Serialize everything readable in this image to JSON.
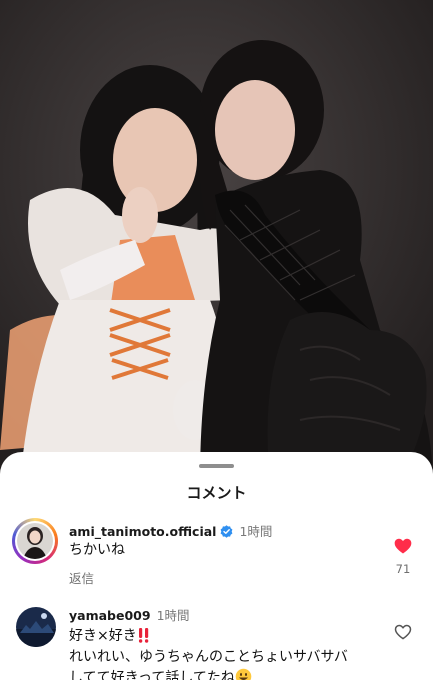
{
  "photo": {
    "description_icon": "photo-of-two-people-icon"
  },
  "comments_sheet": {
    "title": "コメント"
  },
  "comments": [
    {
      "username": "ami_tanimoto.official",
      "verified": true,
      "time": "1時間",
      "text": "ちかいね",
      "reply_label": "返信",
      "liked": true,
      "like_count": "71"
    },
    {
      "username": "yamabe009",
      "verified": false,
      "time": "1時間",
      "line1": "好き×好き",
      "line1_emoji": "double-exclamation-icon",
      "line2": "れいれい、ゆうちゃんのことちょいサバサバ",
      "line3": "してて好きって話してたね",
      "line3_emoji": "grinning-face-icon",
      "liked": false
    }
  ],
  "colors": {
    "like_red": "#ff2d4a",
    "verified_blue": "#2f8ff0"
  }
}
